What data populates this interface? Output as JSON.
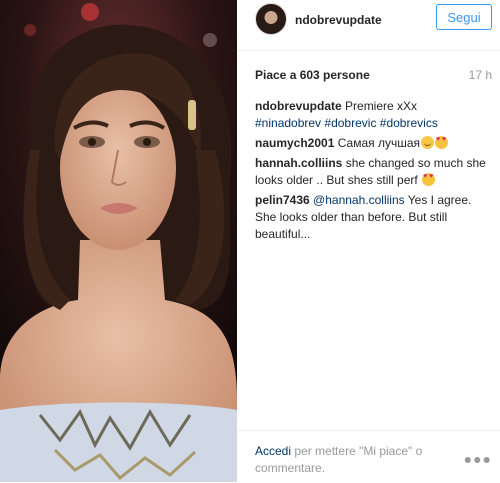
{
  "post": {
    "username": "ndobrevupdate",
    "follow_label": "Segui",
    "likes_text": "Piace a 603 persone",
    "time_ago": "17 h",
    "caption": {
      "user": "ndobrevupdate",
      "text": "Premiere xXx",
      "hashtags": [
        "#ninadobrev",
        "#dobrevic",
        "#dobrevics"
      ]
    },
    "comments": [
      {
        "user": "naumych2001",
        "text": "Самая лучшая",
        "emojis": [
          "smiling-face-emoji",
          "heart-eyes-emoji"
        ]
      },
      {
        "user": "hannah.colliins",
        "text": "she changed so much she looks older .. But shes still perf",
        "emojis": [
          "heart-eyes-emoji"
        ]
      },
      {
        "user": "pelin7436",
        "mention": "@hannah.colliins",
        "text": "Yes I agree. She looks older than before. But still beautiful..."
      }
    ],
    "footer": {
      "login_link": "Accedi",
      "login_rest": "per mettere \"Mi piace\" o commentare."
    },
    "accent_color": "#3897f0",
    "link_color": "#003569"
  }
}
